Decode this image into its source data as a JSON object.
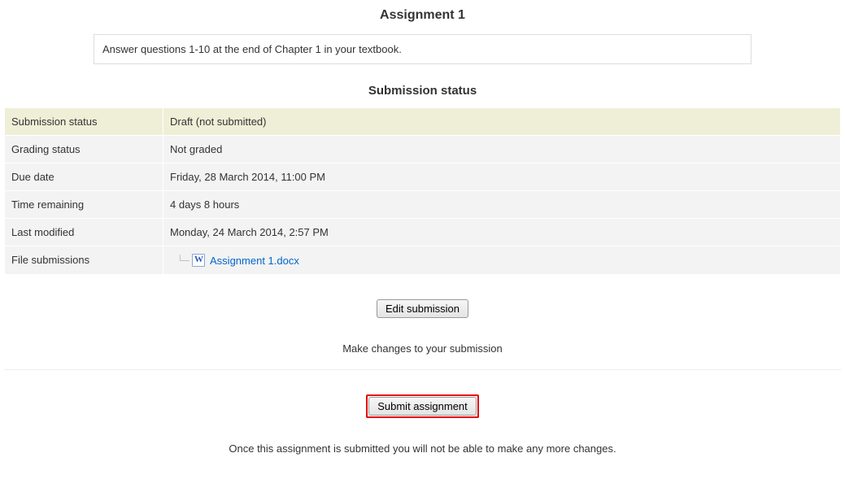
{
  "page_title": "Assignment 1",
  "description": "Answer questions 1-10 at the end of Chapter 1 in your textbook.",
  "section_title": "Submission status",
  "rows": {
    "submission_status": {
      "label": "Submission status",
      "value": "Draft (not submitted)"
    },
    "grading_status": {
      "label": "Grading status",
      "value": "Not graded"
    },
    "due_date": {
      "label": "Due date",
      "value": "Friday, 28 March 2014, 11:00 PM"
    },
    "time_remaining": {
      "label": "Time remaining",
      "value": "4 days 8 hours"
    },
    "last_modified": {
      "label": "Last modified",
      "value": "Monday, 24 March 2014, 2:57 PM"
    },
    "file_submissions": {
      "label": "File submissions",
      "file_name": "Assignment 1.docx"
    }
  },
  "edit_button_label": "Edit submission",
  "edit_hint": "Make changes to your submission",
  "submit_button_label": "Submit assignment",
  "submit_hint": "Once this assignment is submitted you will not be able to make any more changes."
}
